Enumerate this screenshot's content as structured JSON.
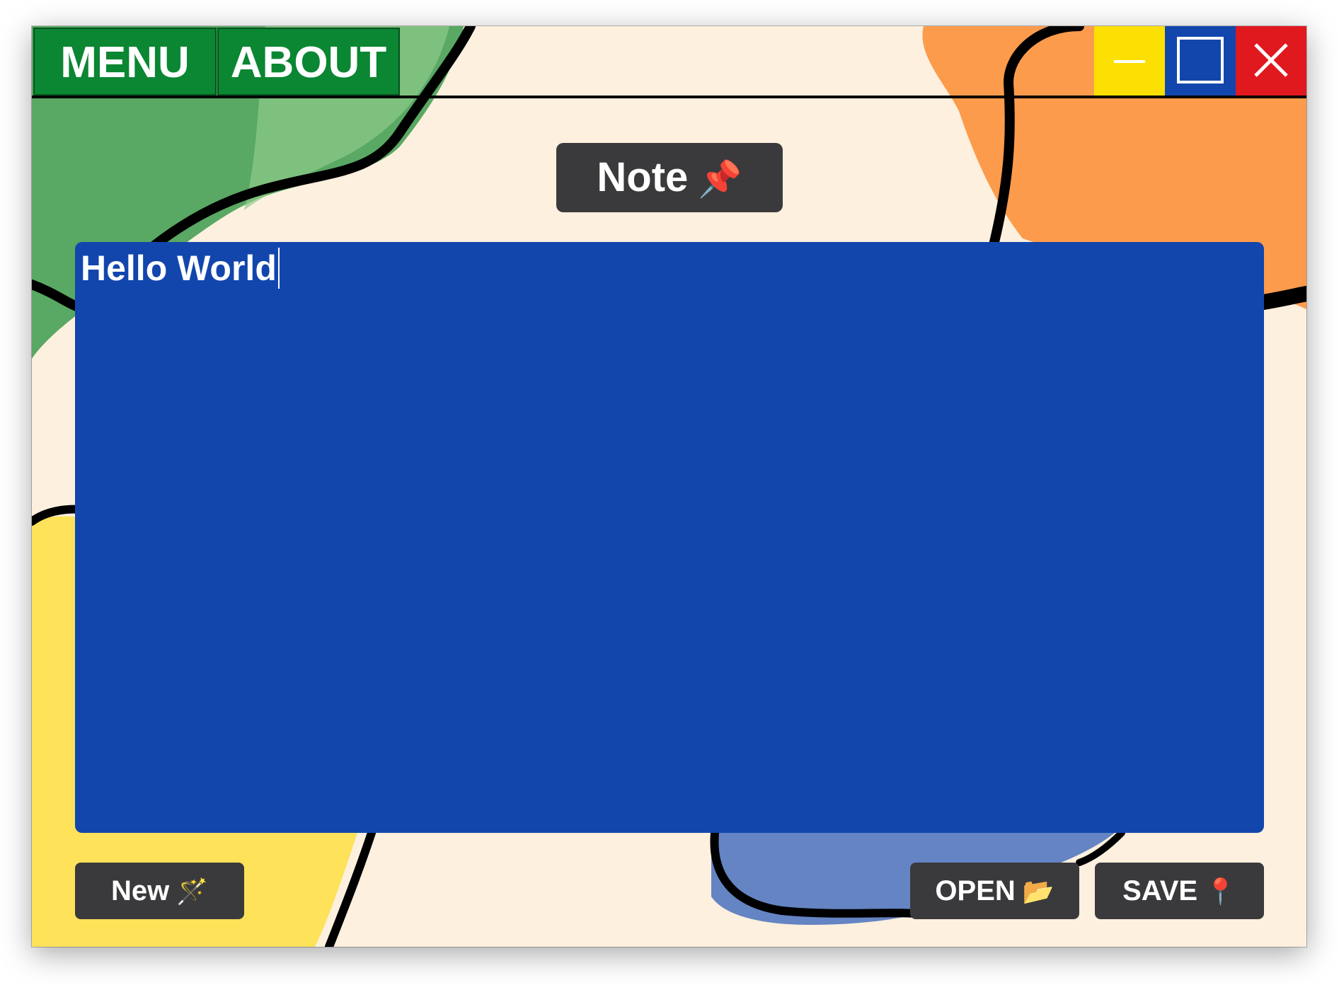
{
  "titlebar": {
    "menu_label": "MENU",
    "about_label": "ABOUT",
    "controls": {
      "minimize_icon": "minimize-icon",
      "maximize_icon": "maximize-icon",
      "close_icon": "close-icon"
    }
  },
  "header": {
    "title": "Note",
    "title_icon": "📌"
  },
  "editor": {
    "content": "Hello World"
  },
  "footer": {
    "new_label": "New",
    "new_icon": "🪄",
    "open_label": "OPEN",
    "open_icon": "📂",
    "save_label": "SAVE",
    "save_icon": "📍"
  },
  "colors": {
    "background": "#fdf0de",
    "menu_green": "#0b8632",
    "minimize_yellow": "#fde003",
    "maximize_blue": "#1246ad",
    "close_red": "#e0191f",
    "editor_blue": "#1246ad",
    "button_dark": "#3a3a3c",
    "blob_green": "#59a863",
    "blob_orange": "#fd9b4c",
    "blob_yellow": "#fde25a",
    "blob_blue": "#6484c3"
  }
}
